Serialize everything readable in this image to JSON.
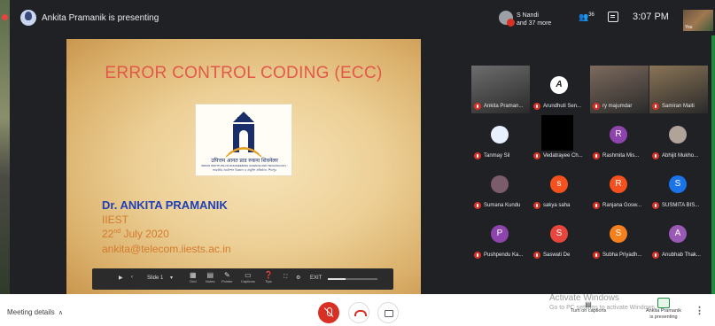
{
  "header": {
    "presenting_text": "Ankita Pramanik is presenting",
    "people_preview_name": "S Nandi",
    "people_preview_more": "and 37 more",
    "people_count_glyph": "👥",
    "people_count": "36",
    "clock": "3:07 PM",
    "self_label": "You"
  },
  "slide": {
    "title": "ERROR CONTROL CODING (ECC)",
    "logo_line1": "उपित्तम आनत प्राड रुकना शिवनेलर",
    "logo_line2": "INDIAN INSTITUTE OF ENGINEERING SCIENCE AND TECHNOLOGY, SHIBPUR",
    "logo_line3": "ভারতীয় প্রকৌশল বিজ্ঞান ও প্রযুক্তি প্রতিষ্ঠান, শিবপুর",
    "author": "Dr. ANKITA PRAMANIK",
    "institute": "IIEST",
    "date_day": "22",
    "date_sup": "nd",
    "date_rest": " July 2020",
    "email": "ankita@telecom.iiests.ac.in",
    "toolbar": {
      "play": "▶",
      "slide_label": "Slide 1",
      "grid": "Grid",
      "notes": "Notes",
      "pointer": "Pointer",
      "captions": "Captions",
      "tips": "Tips",
      "exit": "EXIT"
    }
  },
  "participants": [
    {
      "name": "Ankita Praman...",
      "initial": "",
      "color": "#6d6d6d",
      "kind": "video"
    },
    {
      "name": "Arundhuti Sen...",
      "initial": "A",
      "color": "#ffffff",
      "kind": "letter-dark"
    },
    {
      "name": "ry majumdar",
      "initial": "",
      "color": "#7d6a5d",
      "kind": "video"
    },
    {
      "name": "Samiran Maiti",
      "initial": "",
      "color": "#8a7456",
      "kind": "video"
    },
    {
      "name": "Tanmay Sil",
      "initial": "",
      "color": "#e8f0fe",
      "kind": "photo"
    },
    {
      "name": "Vedatrayee Ch...",
      "initial": "",
      "color": "#000000",
      "kind": "black"
    },
    {
      "name": "Rashmita Mis...",
      "initial": "R",
      "color": "#8e44ad",
      "kind": "letter"
    },
    {
      "name": "Abhijit Mukho...",
      "initial": "",
      "color": "#b0a49a",
      "kind": "photo"
    },
    {
      "name": "Sumana Kundu",
      "initial": "",
      "color": "#7b5c6a",
      "kind": "photo"
    },
    {
      "name": "sakya saha",
      "initial": "s",
      "color": "#f4511e",
      "kind": "letter"
    },
    {
      "name": "Ranjana Gosw...",
      "initial": "R",
      "color": "#f4511e",
      "kind": "letter"
    },
    {
      "name": "SUSMITA BIS...",
      "initial": "S",
      "color": "#1a73e8",
      "kind": "letter"
    },
    {
      "name": "Pushpendu Ka...",
      "initial": "P",
      "color": "#8e44ad",
      "kind": "letter"
    },
    {
      "name": "Saswati De",
      "initial": "S",
      "color": "#e8453c",
      "kind": "letter"
    },
    {
      "name": "Subha Priyadh...",
      "initial": "S",
      "color": "#f4811e",
      "kind": "letter"
    },
    {
      "name": "Anubhab Thak...",
      "initial": "A",
      "color": "#9b59b6",
      "kind": "letter"
    }
  ],
  "footer": {
    "meeting_details": "Meeting details",
    "activate_title": "Activate Windows",
    "activate_sub": "Go to PC settings to activate Windows.",
    "captions_label": "Turn on captions",
    "present_line1": "Ankita Pramanik",
    "present_line2": "is presenting"
  },
  "colors": {
    "mute_red": "#d93025",
    "present_green": "#1e8e3e",
    "slide_title": "#e2584a",
    "slide_author": "#1f3fb6",
    "slide_orange": "#d47a2c"
  }
}
